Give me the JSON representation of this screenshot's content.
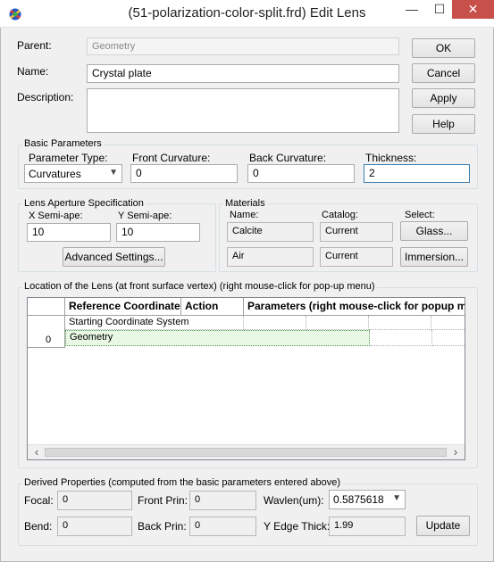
{
  "window": {
    "title": "(51-polarization-color-split.frd) Edit Lens",
    "minimize_glyph": "—",
    "maximize_glyph": "☐",
    "close_glyph": "✕"
  },
  "form": {
    "parent_label": "Parent:",
    "parent_value": "Geometry",
    "name_label": "Name:",
    "name_value": "Crystal plate",
    "description_label": "Description:",
    "description_value": ""
  },
  "buttons": {
    "ok": "OK",
    "cancel": "Cancel",
    "apply": "Apply",
    "help": "Help"
  },
  "basic_parameters": {
    "group_label": "Basic Parameters",
    "parameter_type_label": "Parameter Type:",
    "parameter_type_value": "Curvatures",
    "front_curvature_label": "Front Curvature:",
    "front_curvature_value": "0",
    "back_curvature_label": "Back Curvature:",
    "back_curvature_value": "0",
    "thickness_label": "Thickness:",
    "thickness_value": "2"
  },
  "aperture": {
    "group_label": "Lens Aperture Specification",
    "x_label": "X Semi-ape:",
    "x_value": "10",
    "y_label": "Y Semi-ape:",
    "y_value": "10",
    "advanced_button": "Advanced Settings..."
  },
  "materials": {
    "group_label": "Materials",
    "name_header": "Name:",
    "catalog_header": "Catalog:",
    "select_header": "Select:",
    "rows": [
      {
        "name": "Calcite",
        "catalog": "Current",
        "button": "Glass..."
      },
      {
        "name": "Air",
        "catalog": "Current",
        "button": "Immersion..."
      }
    ]
  },
  "location": {
    "group_label": "Location of the Lens (at front surface vertex)  (right mouse-click for pop-up menu)",
    "columns": [
      "Reference Coordinate",
      "Action",
      "Parameters (right mouse-click for popup me"
    ],
    "rows": [
      {
        "index": "",
        "reference": "Starting Coordinate System"
      },
      {
        "index": "0",
        "reference": "Geometry"
      }
    ],
    "scroll_left_glyph": "‹",
    "scroll_right_glyph": "›"
  },
  "derived": {
    "group_label": "Derived Properties (computed from the basic parameters entered above)",
    "focal_label": "Focal:",
    "focal_value": "0",
    "front_prin_label": "Front Prin:",
    "front_prin_value": "0",
    "wavelen_label": "Wavlen(um):",
    "wavelen_value": "0.5875618",
    "bend_label": "Bend:",
    "bend_value": "0",
    "back_prin_label": "Back Prin:",
    "back_prin_value": "0",
    "y_edge_label": "Y Edge Thick:",
    "y_edge_value": "1.99",
    "update_button": "Update"
  },
  "colors": {
    "close_button": "#c7504a",
    "selected_row": "#e8f8e4"
  }
}
